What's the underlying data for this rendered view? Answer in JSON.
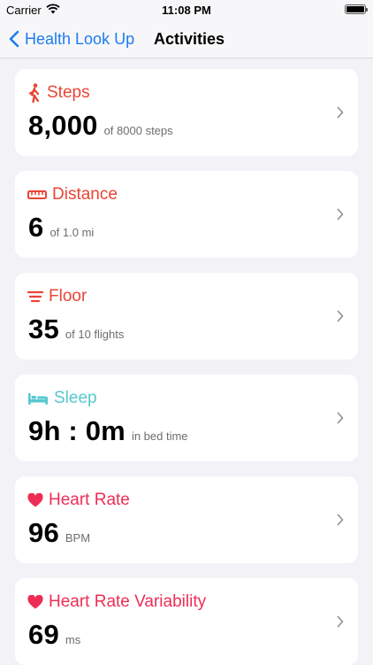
{
  "status_bar": {
    "carrier": "Carrier",
    "time": "11:08 PM"
  },
  "nav": {
    "back_label": "Health Look Up",
    "title": "Activities"
  },
  "colors": {
    "accent_blue": "#1d7cf2",
    "activity_red": "#ea4435",
    "sleep_teal": "#56c8d1",
    "heart_pink": "#ee2d55"
  },
  "cards": [
    {
      "title": "Steps",
      "value": "8,000",
      "unit": "of 8000 steps",
      "icon": "walking-figure-icon",
      "color": "#ea4435"
    },
    {
      "title": "Distance",
      "value": "6",
      "unit": "of 1.0 mi",
      "icon": "ruler-icon",
      "color": "#ea4435"
    },
    {
      "title": "Floor",
      "value": "35",
      "unit": "of 10 flights",
      "icon": "stairs-lines-icon",
      "color": "#ea4435"
    },
    {
      "title": "Sleep",
      "value": "9h : 0m",
      "unit": "in bed time",
      "icon": "bed-icon",
      "color": "#56c8d1"
    },
    {
      "title": "Heart Rate",
      "value": "96",
      "unit": "BPM",
      "icon": "heart-icon",
      "color": "#ee2d55"
    },
    {
      "title": "Heart Rate Variability",
      "value": "69",
      "unit": "ms",
      "icon": "heart-icon",
      "color": "#ee2d55"
    }
  ]
}
